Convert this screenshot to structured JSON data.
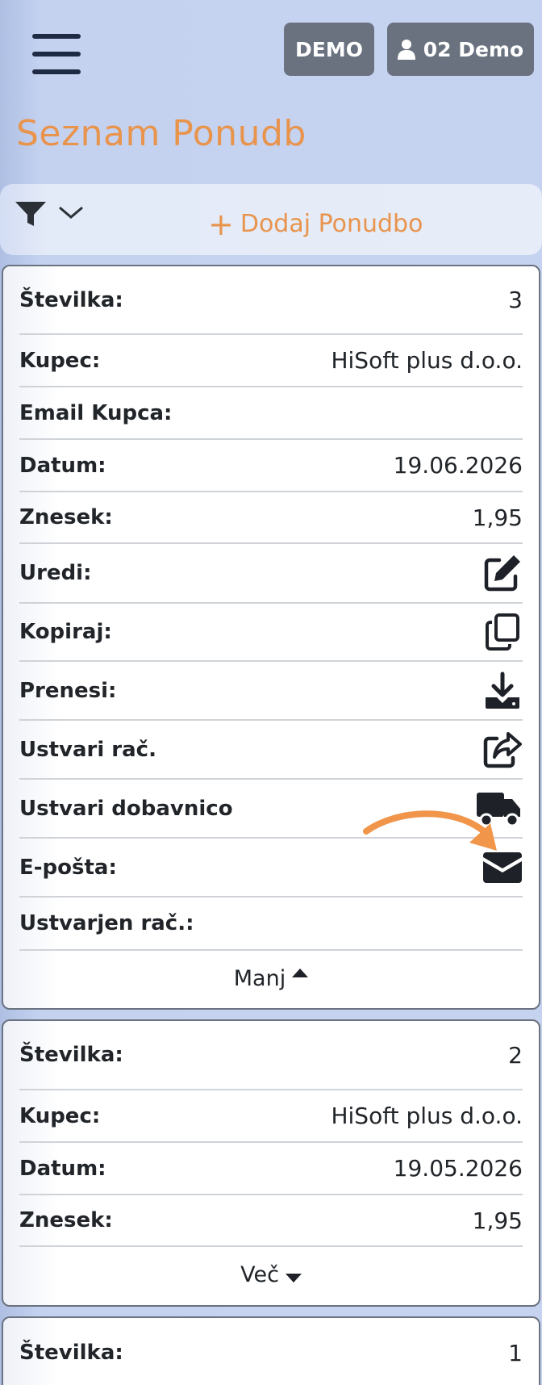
{
  "header": {
    "demo_label": "DEMO",
    "user_label": "02 Demo"
  },
  "page_title": "Seznam Ponudb",
  "toolbar": {
    "add_label": "Dodaj Ponudbo"
  },
  "card1": {
    "stevilka_label": "Številka:",
    "stevilka_value": "3",
    "kupec_label": "Kupec:",
    "kupec_value": "HiSoft plus d.o.o.",
    "email_label": "Email Kupca:",
    "email_value": "",
    "datum_label": "Datum:",
    "datum_value": "19.06.2026",
    "znesek_label": "Znesek:",
    "znesek_value": "1,95",
    "uredi_label": "Uredi:",
    "kopiraj_label": "Kopiraj:",
    "prenesi_label": "Prenesi:",
    "ustvari_rac_label": "Ustvari rač.",
    "ustvari_dob_label": "Ustvari dobavnico",
    "eposta_label": "E-pošta:",
    "ustvarjen_rac_label": "Ustvarjen rač.:",
    "toggle_label": "Manj"
  },
  "card2": {
    "stevilka_label": "Številka:",
    "stevilka_value": "2",
    "kupec_label": "Kupec:",
    "kupec_value": "HiSoft plus d.o.o.",
    "datum_label": "Datum:",
    "datum_value": "19.05.2026",
    "znesek_label": "Znesek:",
    "znesek_value": "1,95",
    "toggle_label": "Več"
  },
  "card3": {
    "stevilka_label": "Številka:",
    "stevilka_value": "1"
  },
  "colors": {
    "accent": "#e8944d",
    "button_gray": "#6a7280",
    "dark": "#1f2a44"
  }
}
